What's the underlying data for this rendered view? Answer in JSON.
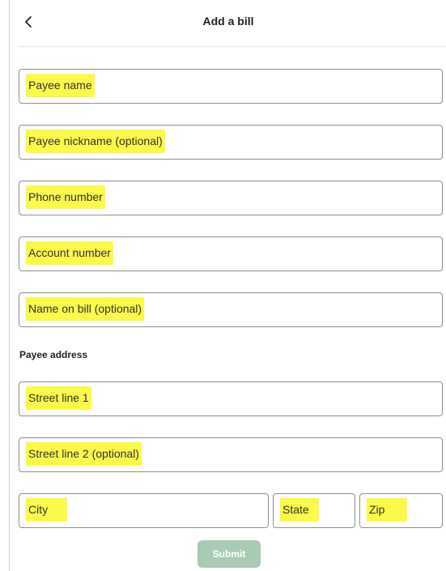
{
  "header": {
    "back_icon": "chevron-left-icon",
    "title": "Add a bill"
  },
  "form": {
    "payee_name_placeholder": "Payee name",
    "payee_nickname_placeholder": "Payee nickname (optional)",
    "phone_number_placeholder": "Phone number",
    "account_number_placeholder": "Account number",
    "name_on_bill_placeholder": "Name on bill (optional)",
    "address_section_label": "Payee address",
    "street_line_1_placeholder": "Street line 1",
    "street_line_2_placeholder": "Street line 2 (optional)",
    "city_placeholder": "City",
    "state_placeholder": "State",
    "zip_placeholder": "Zip",
    "submit_label": "Submit"
  },
  "colors": {
    "highlight": "#fbf94a",
    "field_border": "#8e8e8e",
    "submit_disabled_bg": "#a9cbb3"
  }
}
